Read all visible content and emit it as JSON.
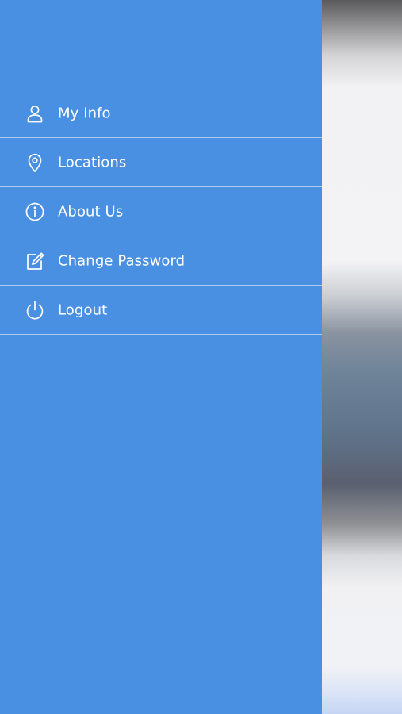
{
  "drawer": {
    "background_color": "#4a90e2",
    "items": [
      {
        "label": "My Info",
        "icon": "user-icon"
      },
      {
        "label": "Locations",
        "icon": "location-pin-icon"
      },
      {
        "label": "About Us",
        "icon": "info-icon"
      },
      {
        "label": "Change Password",
        "icon": "edit-icon"
      },
      {
        "label": "Logout",
        "icon": "power-icon"
      }
    ]
  }
}
